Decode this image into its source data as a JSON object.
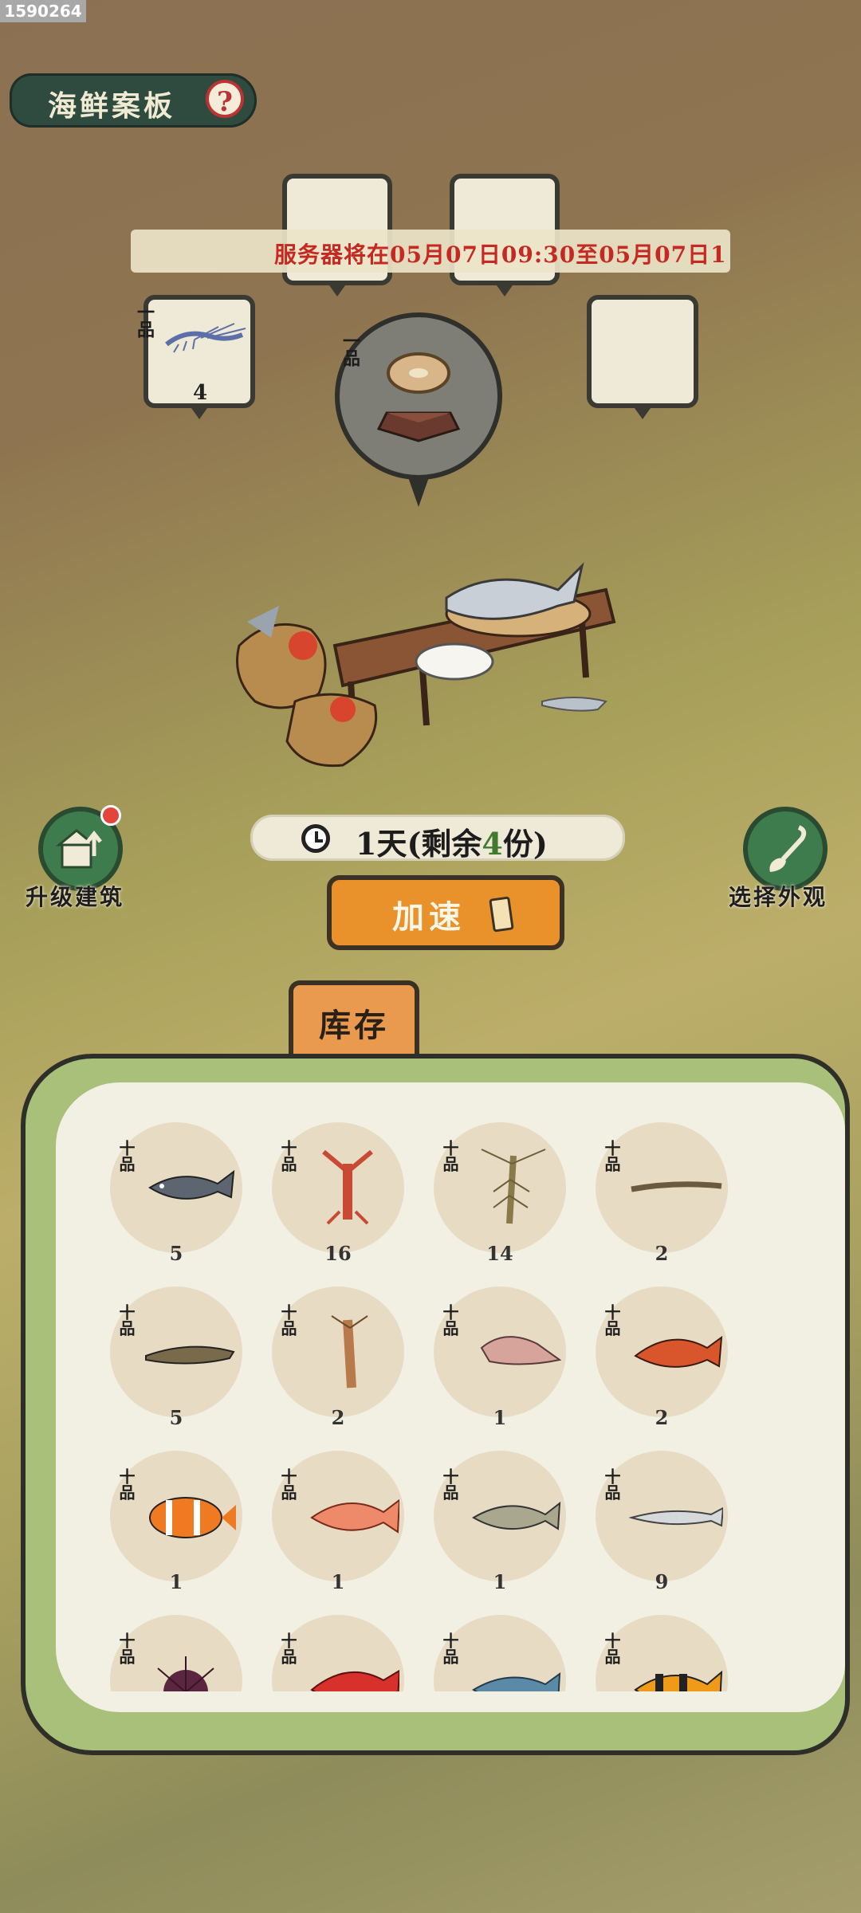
{
  "id_badge": "1590264",
  "header": {
    "title": "海鲜案板",
    "help_icon": "question-mark-icon"
  },
  "banner": {
    "text": "服务器将在05月07日09:30至05月07日1"
  },
  "slots": [
    {
      "grade": "一品",
      "count": "4",
      "item": "shrimp-icon"
    },
    {
      "grade": "一品",
      "item": "fish-steak-icon"
    }
  ],
  "timer": {
    "prefix": "1天(剩余",
    "num": "4",
    "suffix": "份)"
  },
  "speed_button": {
    "label": "加速"
  },
  "left_action": {
    "label": "升级建筑",
    "icon": "upgrade-building-icon"
  },
  "right_action": {
    "label": "选择外观",
    "icon": "paint-brush-icon"
  },
  "tab": {
    "label": "库存"
  },
  "inventory": [
    {
      "grade": "十品",
      "count": "5",
      "icon": "carp-icon"
    },
    {
      "grade": "十品",
      "count": "16",
      "icon": "crayfish-icon"
    },
    {
      "grade": "十品",
      "count": "14",
      "icon": "prawn-icon"
    },
    {
      "grade": "十品",
      "count": "2",
      "icon": "eel-icon"
    },
    {
      "grade": "十品",
      "count": "5",
      "icon": "loach-icon"
    },
    {
      "grade": "十品",
      "count": "2",
      "icon": "mantis-shrimp-icon"
    },
    {
      "grade": "十品",
      "count": "1",
      "icon": "conch-icon"
    },
    {
      "grade": "十品",
      "count": "2",
      "icon": "red-carp-icon"
    },
    {
      "grade": "十品",
      "count": "1",
      "icon": "clownfish-icon"
    },
    {
      "grade": "十品",
      "count": "1",
      "icon": "red-snapper-icon"
    },
    {
      "grade": "十品",
      "count": "1",
      "icon": "bream-icon"
    },
    {
      "grade": "十品",
      "count": "9",
      "icon": "silver-fish-icon"
    },
    {
      "grade": "十品",
      "count": "",
      "icon": "sea-urchin-icon"
    },
    {
      "grade": "十品",
      "count": "",
      "icon": "red-grouper-icon"
    },
    {
      "grade": "十品",
      "count": "",
      "icon": "blue-fish-icon"
    },
    {
      "grade": "十品",
      "count": "",
      "icon": "striped-fish-icon"
    }
  ]
}
